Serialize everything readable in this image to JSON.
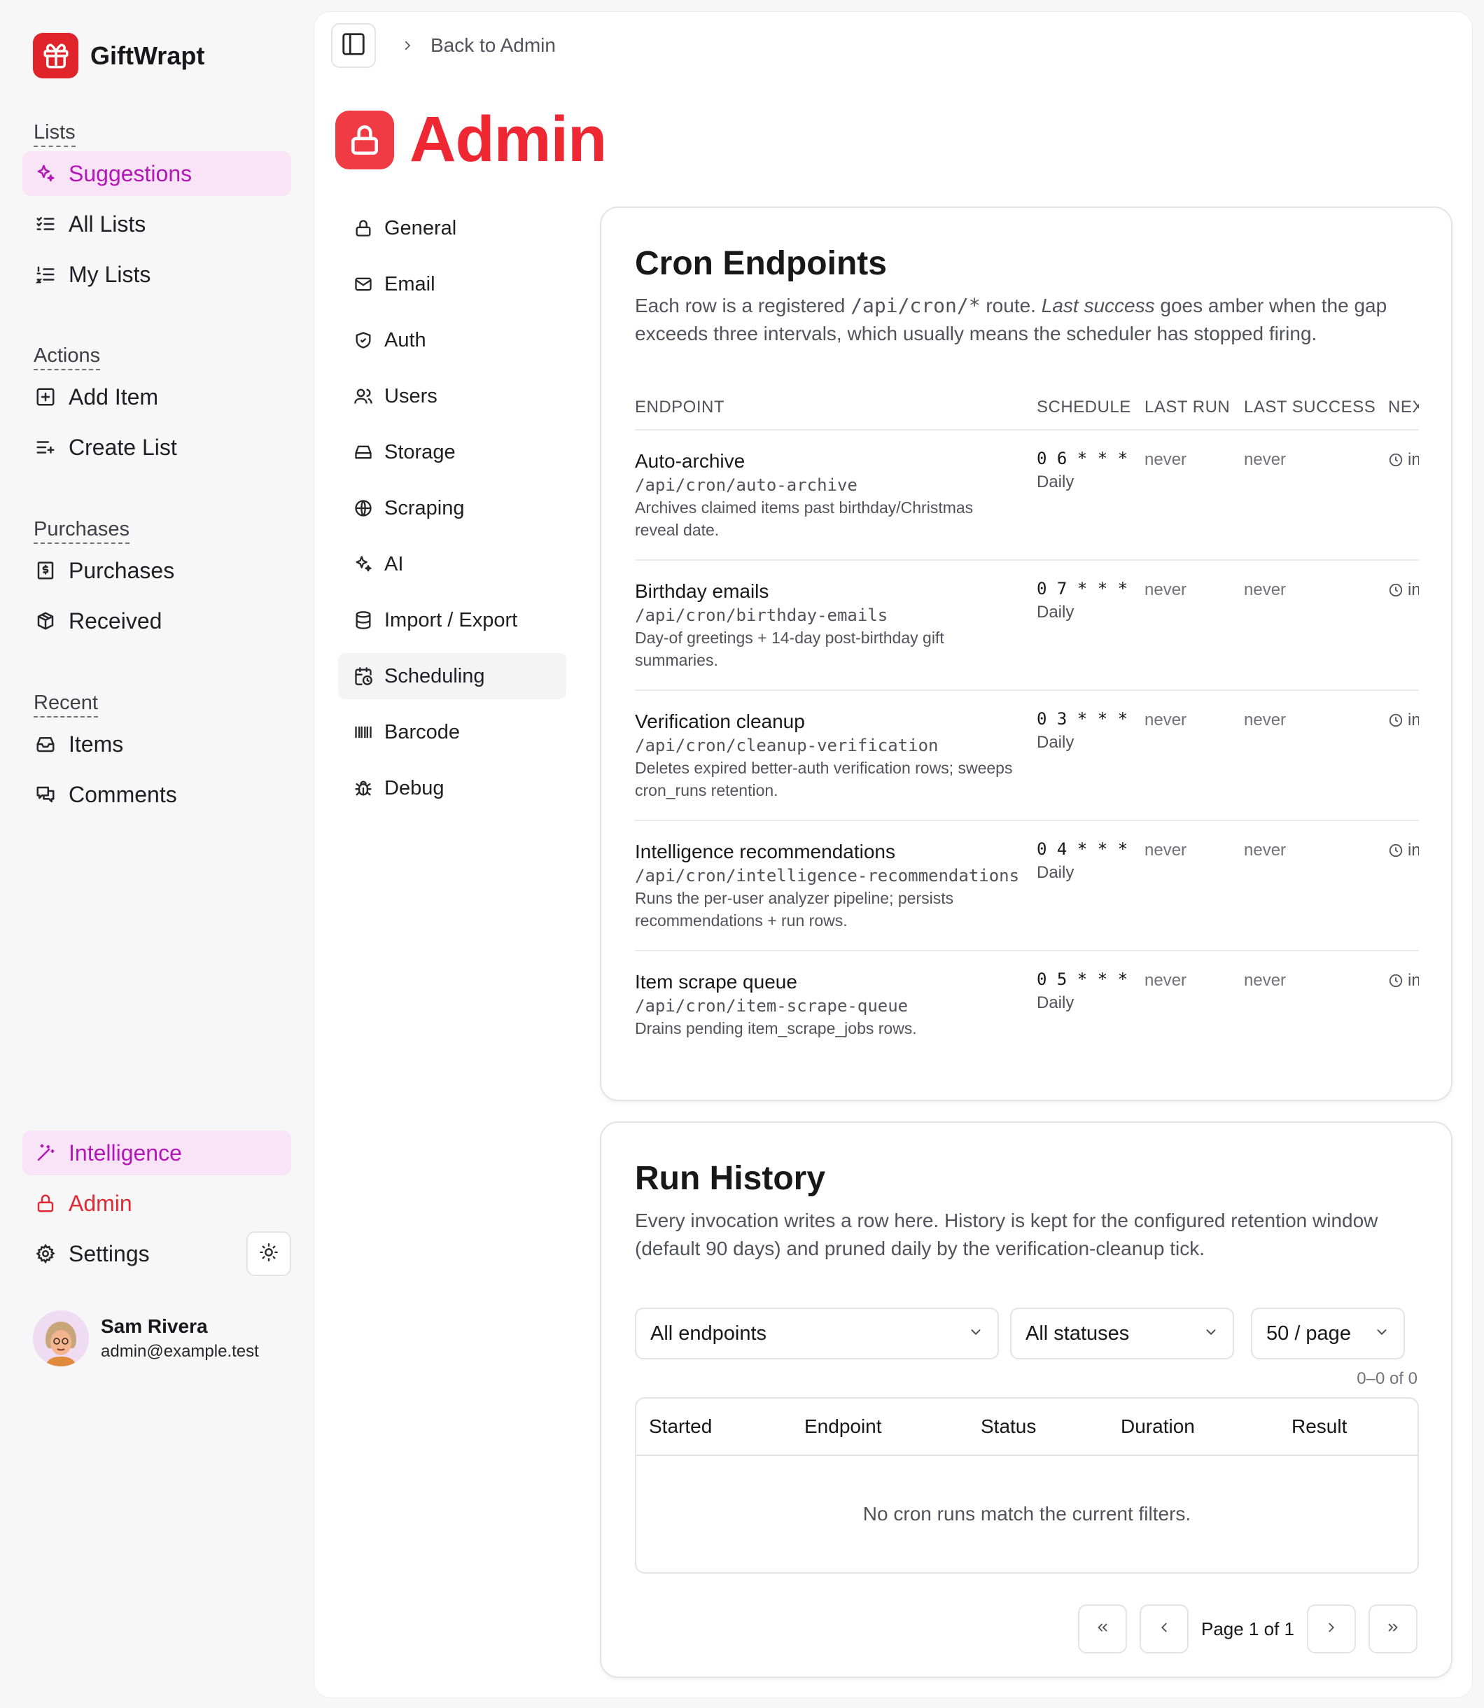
{
  "brand": {
    "name": "GiftWrapt",
    "color": "#e0242b"
  },
  "sidebar": {
    "sections": [
      {
        "label": "Lists",
        "items": [
          {
            "label": "Suggestions",
            "icon": "sparkles-icon",
            "active": true
          },
          {
            "label": "All Lists",
            "icon": "list-checks-icon"
          },
          {
            "label": "My Lists",
            "icon": "list-ordered-icon"
          }
        ]
      },
      {
        "label": "Actions",
        "items": [
          {
            "label": "Add Item",
            "icon": "square-plus-icon"
          },
          {
            "label": "Create List",
            "icon": "list-plus-icon"
          }
        ]
      },
      {
        "label": "Purchases",
        "items": [
          {
            "label": "Purchases",
            "icon": "receipt-icon"
          },
          {
            "label": "Received",
            "icon": "gift-box-icon"
          }
        ]
      },
      {
        "label": "Recent",
        "items": [
          {
            "label": "Items",
            "icon": "inbox-icon"
          },
          {
            "label": "Comments",
            "icon": "comments-icon"
          }
        ]
      }
    ],
    "bottom": {
      "intelligence": "Intelligence",
      "admin": "Admin",
      "settings": "Settings"
    },
    "user": {
      "name": "Sam Rivera",
      "email": "admin@example.test"
    }
  },
  "topbar": {
    "back_label": "Back to Admin"
  },
  "page": {
    "title": "Admin",
    "accent": "#ee2733"
  },
  "subnav": [
    {
      "label": "General",
      "icon": "lock-icon"
    },
    {
      "label": "Email",
      "icon": "mail-icon"
    },
    {
      "label": "Auth",
      "icon": "shield-icon"
    },
    {
      "label": "Users",
      "icon": "users-icon"
    },
    {
      "label": "Storage",
      "icon": "hard-drive-icon"
    },
    {
      "label": "Scraping",
      "icon": "globe-icon"
    },
    {
      "label": "AI",
      "icon": "sparkles-icon"
    },
    {
      "label": "Import / Export",
      "icon": "database-icon"
    },
    {
      "label": "Scheduling",
      "icon": "calendar-clock-icon",
      "active": true
    },
    {
      "label": "Barcode",
      "icon": "barcode-icon"
    },
    {
      "label": "Debug",
      "icon": "bug-icon"
    }
  ],
  "cron": {
    "title": "Cron Endpoints",
    "desc_1": "Each row is a registered ",
    "desc_code": "/api/cron/*",
    "desc_2": " route. ",
    "desc_em": "Last success",
    "desc_3": " goes amber when the gap exceeds three intervals, which usually means the scheduler has stopped firing.",
    "columns": {
      "endpoint": "ENDPOINT",
      "schedule": "SCHEDULE",
      "last_run": "LAST RUN",
      "last_success": "LAST SUCCESS",
      "next": "NEXT"
    },
    "rows": [
      {
        "name": "Auto-archive",
        "path": "/api/cron/auto-archive",
        "desc": "Archives claimed items past birthday/Christmas reveal date.",
        "expr": "0 6 * * *",
        "freq": "Daily",
        "last_run": "never",
        "last_success": "never",
        "next": "in"
      },
      {
        "name": "Birthday emails",
        "path": "/api/cron/birthday-emails",
        "desc": "Day-of greetings + 14-day post-birthday gift summaries.",
        "expr": "0 7 * * *",
        "freq": "Daily",
        "last_run": "never",
        "last_success": "never",
        "next": "in"
      },
      {
        "name": "Verification cleanup",
        "path": "/api/cron/cleanup-verification",
        "desc": "Deletes expired better-auth verification rows; sweeps cron_runs retention.",
        "expr": "0 3 * * *",
        "freq": "Daily",
        "last_run": "never",
        "last_success": "never",
        "next": "in"
      },
      {
        "name": "Intelligence recommendations",
        "path": "/api/cron/intelligence-recommendations",
        "desc": "Runs the per-user analyzer pipeline; persists recommendations + run rows.",
        "expr": "0 4 * * *",
        "freq": "Daily",
        "last_run": "never",
        "last_success": "never",
        "next": "in"
      },
      {
        "name": "Item scrape queue",
        "path": "/api/cron/item-scrape-queue",
        "desc": "Drains pending item_scrape_jobs rows.",
        "expr": "0 5 * * *",
        "freq": "Daily",
        "last_run": "never",
        "last_success": "never",
        "next": "in"
      }
    ]
  },
  "history": {
    "title": "Run History",
    "desc": "Every invocation writes a row here. History is kept for the configured retention window (default 90 days) and pruned daily by the verification-cleanup tick.",
    "filters": {
      "endpoint": "All endpoints",
      "status": "All statuses",
      "per_page": "50 / page"
    },
    "count": "0–0 of 0",
    "columns": {
      "started": "Started",
      "endpoint": "Endpoint",
      "status": "Status",
      "duration": "Duration",
      "result": "Result"
    },
    "empty": "No cron runs match the current filters.",
    "page_label": "Page 1 of 1"
  }
}
